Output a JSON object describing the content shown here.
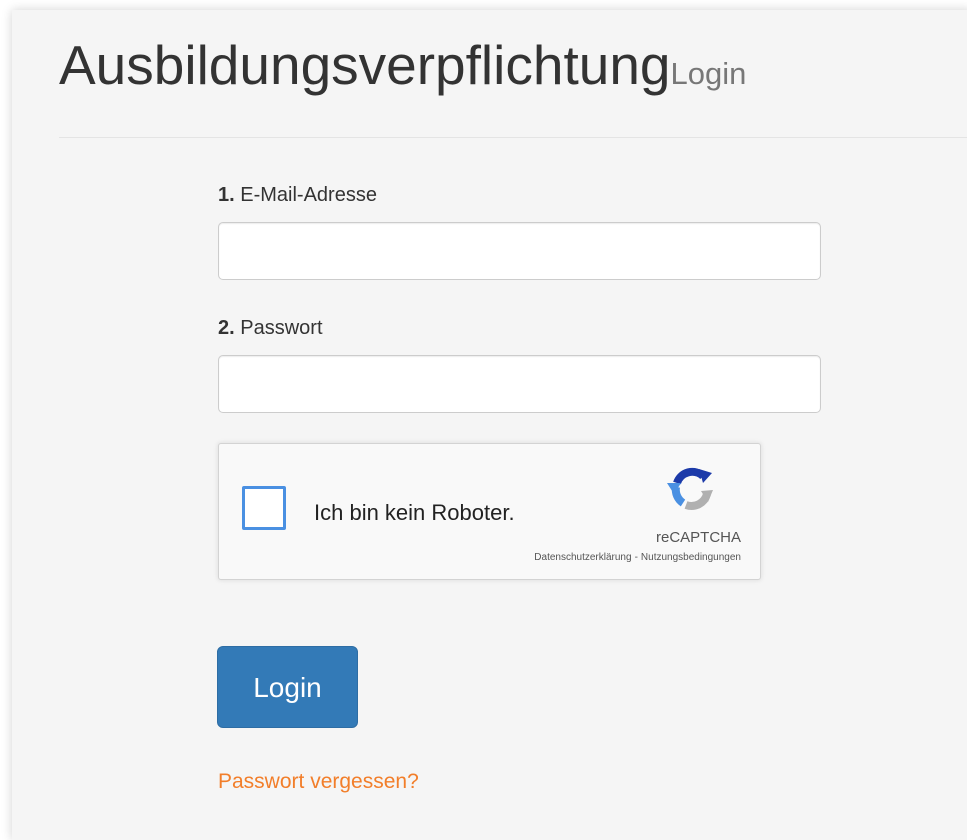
{
  "header": {
    "title": "Ausbildungsverpflichtung",
    "subtitle": "Login"
  },
  "form": {
    "email": {
      "number": "1.",
      "label": "E-Mail-Adresse",
      "value": "",
      "placeholder": ""
    },
    "password": {
      "number": "2.",
      "label": "Passwort",
      "value": "",
      "placeholder": ""
    },
    "recaptcha": {
      "checkbox_label": "Ich bin kein Roboter.",
      "brand": "reCAPTCHA",
      "privacy_link": "Datenschutzerklärung",
      "separator": "-",
      "terms_link": "Nutzungsbedingungen",
      "checked": false
    },
    "submit_label": "Login",
    "forgot_link": "Passwort vergessen?"
  },
  "colors": {
    "primary_button": "#337ab7",
    "link": "#f27e2a",
    "checkbox_border": "#4a90e2",
    "recaptcha_blue": "#1c3aa9",
    "recaptcha_light_blue": "#4a90e2",
    "recaptcha_gray": "#b0b0b0"
  },
  "icons": {
    "recaptcha_logo": "recaptcha-logo-icon"
  }
}
